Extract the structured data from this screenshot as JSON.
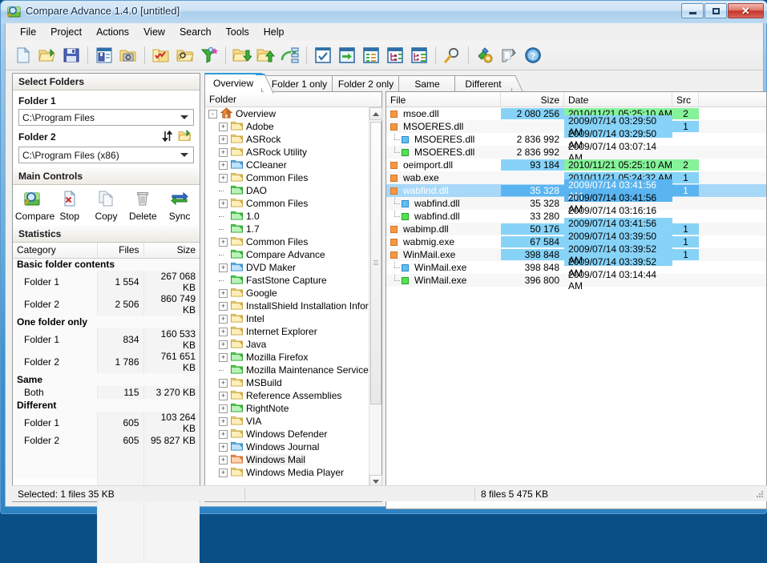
{
  "window": {
    "title": "Compare Advance 1.4.0 [untitled]",
    "icon": "compare-app-icon",
    "minimize_label": "Minimize",
    "maximize_label": "Maximize",
    "close_label": "Close"
  },
  "menubar": {
    "items": [
      {
        "label": "File"
      },
      {
        "label": "Project"
      },
      {
        "label": "Actions"
      },
      {
        "label": "View"
      },
      {
        "label": "Search"
      },
      {
        "label": "Tools"
      },
      {
        "label": "Help"
      }
    ]
  },
  "toolbar": {
    "buttons": [
      {
        "name": "new-project-icon",
        "tip": "New"
      },
      {
        "name": "open-project-icon",
        "tip": "Open"
      },
      {
        "name": "save-project-icon",
        "tip": "Save"
      },
      {
        "name": "separator",
        "tip": ""
      },
      {
        "name": "save-session-icon",
        "tip": "Save session"
      },
      {
        "name": "load-snapshot-icon",
        "tip": "Snapshot"
      },
      {
        "name": "separator",
        "tip": ""
      },
      {
        "name": "select-folder-checked-icon",
        "tip": "Select"
      },
      {
        "name": "browse-folder-icon",
        "tip": "Browse"
      },
      {
        "name": "filter-icon",
        "tip": "Filter"
      },
      {
        "name": "separator",
        "tip": ""
      },
      {
        "name": "copy-down-icon",
        "tip": "Copy to folder 2"
      },
      {
        "name": "copy-up-icon",
        "tip": "Copy to folder 1"
      },
      {
        "name": "sync-tree-icon",
        "tip": "Synchronize"
      },
      {
        "name": "separator",
        "tip": ""
      },
      {
        "name": "check-all-icon",
        "tip": "Check all"
      },
      {
        "name": "move-panel-icon",
        "tip": "Move"
      },
      {
        "name": "list-view-icon",
        "tip": "List view"
      },
      {
        "name": "tree-view-left-icon",
        "tip": "Tree view"
      },
      {
        "name": "tree-view-split-icon",
        "tip": "Split view"
      },
      {
        "name": "separator",
        "tip": ""
      },
      {
        "name": "search-icon",
        "tip": "Search"
      },
      {
        "name": "separator",
        "tip": ""
      },
      {
        "name": "options-icon",
        "tip": "Options"
      },
      {
        "name": "notes-icon",
        "tip": "Notes"
      },
      {
        "name": "help-icon",
        "tip": "Help"
      }
    ]
  },
  "sidebar": {
    "select_folders": {
      "header": "Select Folders",
      "folder1_label": "Folder 1",
      "folder1_value": "C:\\Program Files",
      "folder2_label": "Folder 2",
      "folder2_value": "C:\\Program Files (x86)",
      "swap_icon": "swap-folders-icon",
      "browse_icon": "browse-folder-icon"
    },
    "main_controls": {
      "header": "Main Controls",
      "buttons": [
        {
          "label": "Compare",
          "icon": "compare-icon"
        },
        {
          "label": "Stop",
          "icon": "stop-icon"
        },
        {
          "label": "Copy",
          "icon": "copy-icon"
        },
        {
          "label": "Delete",
          "icon": "delete-icon"
        },
        {
          "label": "Sync",
          "icon": "sync-icon"
        }
      ]
    },
    "statistics": {
      "header": "Statistics",
      "columns": [
        "Category",
        "Files",
        "Size"
      ],
      "rows": [
        {
          "type": "group",
          "category": "Basic folder contents",
          "files": "",
          "size": ""
        },
        {
          "type": "item",
          "category": "Folder 1",
          "files": "1 554",
          "size": "267 068 KB"
        },
        {
          "type": "item",
          "category": "Folder 2",
          "files": "2 506",
          "size": "860 749 KB"
        },
        {
          "type": "group",
          "category": "One folder only",
          "files": "",
          "size": ""
        },
        {
          "type": "item",
          "category": "Folder 1",
          "files": "834",
          "size": "160 533 KB"
        },
        {
          "type": "item",
          "category": "Folder 2",
          "files": "1 786",
          "size": "761 651 KB"
        },
        {
          "type": "group",
          "category": "Same",
          "files": "",
          "size": ""
        },
        {
          "type": "item",
          "category": "Both",
          "files": "115",
          "size": "3 270 KB"
        },
        {
          "type": "group",
          "category": "Different",
          "files": "",
          "size": ""
        },
        {
          "type": "item",
          "category": "Folder 1",
          "files": "605",
          "size": "103 264 KB"
        },
        {
          "type": "item",
          "category": "Folder 2",
          "files": "605",
          "size": "95 827 KB"
        }
      ]
    }
  },
  "tabs": [
    {
      "label": "Overview",
      "active": true
    },
    {
      "label": "Folder 1 only",
      "active": false
    },
    {
      "label": "Folder 2 only",
      "active": false
    },
    {
      "label": "Same",
      "active": false
    },
    {
      "label": "Different",
      "active": false
    }
  ],
  "tree": {
    "column_header": "Folder",
    "nodes": [
      {
        "label": "Overview",
        "depth": 0,
        "expander": "-",
        "icon": "home-icon",
        "selected": false
      },
      {
        "label": "Adobe",
        "depth": 1,
        "expander": "+",
        "icon": "folder-yellow-icon",
        "selected": false
      },
      {
        "label": "ASRock",
        "depth": 1,
        "expander": "+",
        "icon": "folder-yellow-icon",
        "selected": false
      },
      {
        "label": "ASRock Utility",
        "depth": 1,
        "expander": "+",
        "icon": "folder-yellow-icon",
        "selected": false
      },
      {
        "label": "CCleaner",
        "depth": 1,
        "expander": "+",
        "icon": "folder-blue-icon",
        "selected": false
      },
      {
        "label": "Common Files",
        "depth": 1,
        "expander": "+",
        "icon": "folder-yellow-icon",
        "selected": false
      },
      {
        "label": "DAO",
        "depth": 1,
        "expander": "",
        "icon": "folder-green-icon",
        "selected": false
      },
      {
        "label": "Common Files",
        "depth": 1,
        "expander": "+",
        "icon": "folder-yellow-icon",
        "selected": false
      },
      {
        "label": "1.0",
        "depth": 1,
        "expander": "",
        "icon": "folder-green-icon",
        "selected": false
      },
      {
        "label": "1.7",
        "depth": 1,
        "expander": "",
        "icon": "folder-green-icon",
        "selected": false
      },
      {
        "label": "Common Files",
        "depth": 1,
        "expander": "+",
        "icon": "folder-yellow-icon",
        "selected": false
      },
      {
        "label": "Compare Advance",
        "depth": 1,
        "expander": "",
        "icon": "folder-green-icon",
        "selected": false
      },
      {
        "label": "DVD Maker",
        "depth": 1,
        "expander": "+",
        "icon": "folder-blue-icon",
        "selected": false
      },
      {
        "label": "FastStone Capture",
        "depth": 1,
        "expander": "",
        "icon": "folder-green-icon",
        "selected": false
      },
      {
        "label": "Google",
        "depth": 1,
        "expander": "+",
        "icon": "folder-yellow-icon",
        "selected": false
      },
      {
        "label": "InstallShield Installation Inforr",
        "depth": 1,
        "expander": "+",
        "icon": "folder-yellow-icon",
        "selected": false
      },
      {
        "label": "Intel",
        "depth": 1,
        "expander": "+",
        "icon": "folder-yellow-icon",
        "selected": false
      },
      {
        "label": "Internet Explorer",
        "depth": 1,
        "expander": "+",
        "icon": "folder-yellow-icon",
        "selected": false
      },
      {
        "label": "Java",
        "depth": 1,
        "expander": "+",
        "icon": "folder-yellow-icon",
        "selected": false
      },
      {
        "label": "Mozilla Firefox",
        "depth": 1,
        "expander": "+",
        "icon": "folder-green-icon",
        "selected": false
      },
      {
        "label": "Mozilla Maintenance Service",
        "depth": 1,
        "expander": "",
        "icon": "folder-green-icon",
        "selected": false
      },
      {
        "label": "MSBuild",
        "depth": 1,
        "expander": "+",
        "icon": "folder-yellow-icon",
        "selected": false
      },
      {
        "label": "Reference Assemblies",
        "depth": 1,
        "expander": "+",
        "icon": "folder-yellow-icon",
        "selected": false
      },
      {
        "label": "RightNote",
        "depth": 1,
        "expander": "+",
        "icon": "folder-green-icon",
        "selected": false
      },
      {
        "label": "VIA",
        "depth": 1,
        "expander": "+",
        "icon": "folder-yellow-icon",
        "selected": false
      },
      {
        "label": "Windows Defender",
        "depth": 1,
        "expander": "+",
        "icon": "folder-yellow-icon",
        "selected": false
      },
      {
        "label": "Windows Journal",
        "depth": 1,
        "expander": "+",
        "icon": "folder-blue-icon",
        "selected": false
      },
      {
        "label": "Windows Mail",
        "depth": 1,
        "expander": "+",
        "icon": "folder-orange-icon",
        "selected": true
      },
      {
        "label": "Windows Media Player",
        "depth": 1,
        "expander": "+",
        "icon": "folder-yellow-icon",
        "selected": false
      }
    ]
  },
  "filelist": {
    "columns": [
      "File",
      "Size",
      "Date",
      "Src"
    ],
    "rows": [
      {
        "name": "msoe.dll",
        "marker": "orange",
        "child": false,
        "size": "2 080 256",
        "date": "2010/11/21 05:25:10 AM",
        "src": "2",
        "size_hl": "blue",
        "date_hl": "green",
        "src_hl": "green",
        "selected": false
      },
      {
        "name": "MSOERES.dll",
        "marker": "orange",
        "child": false,
        "size": "",
        "date": "2009/07/14 03:29:50 AM",
        "src": "1",
        "size_hl": "",
        "date_hl": "blue",
        "src_hl": "blue",
        "selected": false
      },
      {
        "name": "MSOERES.dll",
        "marker": "blue",
        "child": true,
        "size": "2 836 992",
        "date": "2009/07/14 03:29:50 AM",
        "src": "",
        "size_hl": "",
        "date_hl": "",
        "src_hl": "",
        "selected": false
      },
      {
        "name": "MSOERES.dll",
        "marker": "green",
        "child": true,
        "size": "2 836 992",
        "date": "2009/07/14 03:07:14 AM",
        "src": "",
        "size_hl": "",
        "date_hl": "",
        "src_hl": "",
        "selected": false
      },
      {
        "name": "oeimport.dll",
        "marker": "orange",
        "child": false,
        "size": "93 184",
        "date": "2010/11/21 05:25:10 AM",
        "src": "2",
        "size_hl": "blue",
        "date_hl": "green",
        "src_hl": "green",
        "selected": false
      },
      {
        "name": "wab.exe",
        "marker": "orange",
        "child": false,
        "size": "",
        "date": "2010/11/21 05:24:32 AM",
        "src": "1",
        "size_hl": "",
        "date_hl": "blue",
        "src_hl": "blue",
        "selected": false
      },
      {
        "name": "wabfind.dll",
        "marker": "orange",
        "child": false,
        "size": "35 328",
        "date": "2009/07/14 03:41:56 AM",
        "src": "1",
        "size_hl": "bluesel",
        "date_hl": "bluesel",
        "src_hl": "bluesel",
        "selected": true
      },
      {
        "name": "wabfind.dll",
        "marker": "blue",
        "child": true,
        "size": "35 328",
        "date": "2009/07/14 03:41:56 AM",
        "src": "",
        "size_hl": "",
        "date_hl": "",
        "src_hl": "",
        "selected": false
      },
      {
        "name": "wabfind.dll",
        "marker": "green",
        "child": true,
        "size": "33 280",
        "date": "2009/07/14 03:16:16 AM",
        "src": "",
        "size_hl": "",
        "date_hl": "",
        "src_hl": "",
        "selected": false
      },
      {
        "name": "wabimp.dll",
        "marker": "orange",
        "child": false,
        "size": "50 176",
        "date": "2009/07/14 03:41:56 AM",
        "src": "1",
        "size_hl": "blue",
        "date_hl": "blue",
        "src_hl": "blue",
        "selected": false
      },
      {
        "name": "wabmig.exe",
        "marker": "orange",
        "child": false,
        "size": "67 584",
        "date": "2009/07/14 03:39:50 AM",
        "src": "1",
        "size_hl": "blue",
        "date_hl": "blue",
        "src_hl": "blue",
        "selected": false
      },
      {
        "name": "WinMail.exe",
        "marker": "orange",
        "child": false,
        "size": "398 848",
        "date": "2009/07/14 03:39:52 AM",
        "src": "1",
        "size_hl": "blue",
        "date_hl": "blue",
        "src_hl": "blue",
        "selected": false
      },
      {
        "name": "WinMail.exe",
        "marker": "blue",
        "child": true,
        "size": "398 848",
        "date": "2009/07/14 03:39:52 AM",
        "src": "",
        "size_hl": "",
        "date_hl": "",
        "src_hl": "",
        "selected": false
      },
      {
        "name": "WinMail.exe",
        "marker": "green",
        "child": true,
        "size": "396 800",
        "date": "2009/07/14 03:14:44 AM",
        "src": "",
        "size_hl": "",
        "date_hl": "",
        "src_hl": "",
        "selected": false
      }
    ]
  },
  "statusbar": {
    "selected_text": "Selected: 1 files 35 KB",
    "middle_text": "",
    "right_text": "8 files 5 475 KB"
  },
  "colors": {
    "accent": "#2e9bd8",
    "highlight_blue": "#87d3f8",
    "highlight_green": "#86f29a",
    "selection_blue": "#a8d8f8",
    "marker_orange": "#f79642",
    "marker_blue": "#5fc0f5",
    "marker_green": "#54e154"
  }
}
